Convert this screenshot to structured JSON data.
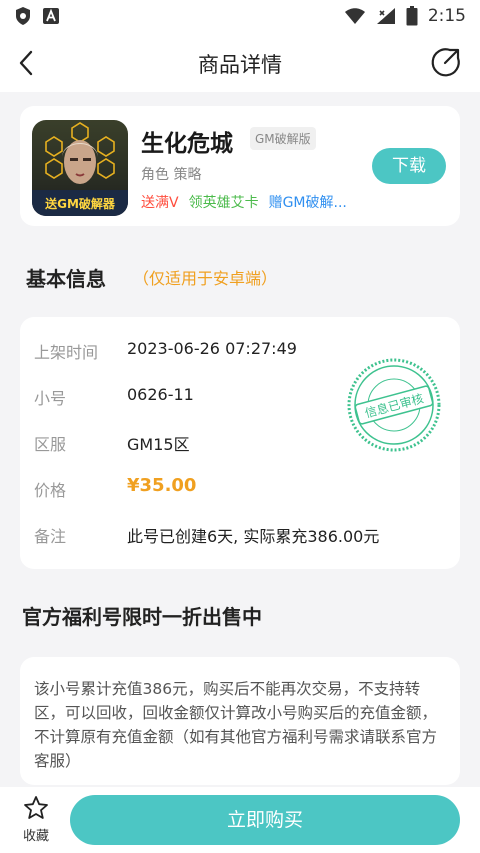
{
  "statusbar": {
    "time": "2:15",
    "left_icons": [
      "shield-icon",
      "a-icon"
    ],
    "right_icons": [
      "wifi-icon",
      "signal-icon",
      "battery-icon"
    ]
  },
  "navbar": {
    "title": "商品详情",
    "back_icon": "back-icon",
    "share_icon": "share-icon"
  },
  "game": {
    "name": "生化危城",
    "tag": "GM破解版",
    "categories": "角色 策略",
    "perks": [
      "送满V",
      "领英雄艾卡",
      "赠GM破解..."
    ],
    "download_label": "下载",
    "thumb_text": "送GM破解器"
  },
  "basic_info": {
    "title": "基本信息",
    "note": "（仅适用于安卓端）",
    "rows": [
      {
        "label": "上架时间",
        "value": "2023-06-26 07:27:49"
      },
      {
        "label": "小号",
        "value": "0626-11"
      },
      {
        "label": "区服",
        "value": "GM15区"
      },
      {
        "label": "价格",
        "value": "¥35.00"
      },
      {
        "label": "备注",
        "value": "此号已创建6天, 实际累充386.00元"
      }
    ],
    "stamp_text": "信息已审核"
  },
  "offer": {
    "title": "官方福利号限时一折出售中",
    "description": "该小号累计充值386元，购买后不能再次交易，不支持转区，可以回收，回收金额仅计算改小号购买后的充值金额，不计算原有充值金额（如有其他官方福利号需求请联系官方客服）"
  },
  "bottom": {
    "fav_label": "收藏",
    "buy_label": "立即购买"
  },
  "colors": {
    "accent": "#4cc6c4",
    "price": "#f0a020",
    "perk_red": "#ff4d3d",
    "perk_green": "#4cbb4c",
    "perk_blue": "#2f8ff0",
    "stamp": "#3ec28f"
  }
}
